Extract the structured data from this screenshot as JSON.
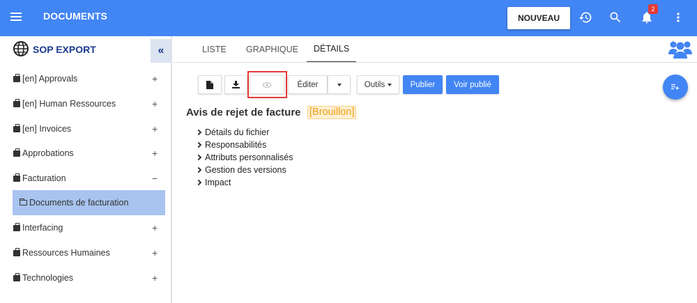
{
  "topbar": {
    "title": "DOCUMENTS",
    "new_button": "NOUVEAU",
    "notification_count": "2",
    "icons": [
      "menu-icon",
      "history-icon",
      "search-icon",
      "bell-icon",
      "more-vert-icon"
    ]
  },
  "sidebar": {
    "title": "SOP EXPORT",
    "collapse_glyph": "«",
    "items": [
      {
        "label": "[en] Approvals",
        "toggle": "+"
      },
      {
        "label": "[en] Human Ressources",
        "toggle": "+"
      },
      {
        "label": "[en] Invoices",
        "toggle": "+"
      },
      {
        "label": "Approbations",
        "toggle": "+"
      },
      {
        "label": "Facturation",
        "toggle": "−"
      },
      {
        "label": "Interfacing",
        "toggle": "+"
      },
      {
        "label": "Ressources Humaines",
        "toggle": "+"
      },
      {
        "label": "Technologies",
        "toggle": "+"
      }
    ],
    "sub_item": {
      "label": "Documents de facturation"
    }
  },
  "tabs": [
    {
      "label": "LISTE"
    },
    {
      "label": "GRAPHIQUE"
    },
    {
      "label": "DÉTAILS"
    }
  ],
  "toolbar": {
    "edit_label": "Éditer",
    "tools_label": "Outils",
    "publish_label": "Publier",
    "view_published_label": "Voir publié"
  },
  "document": {
    "title": "Avis de rejet de facture",
    "status": "[Brouillon]",
    "sections": [
      {
        "label": "Détails du fichier"
      },
      {
        "label": "Responsabilités"
      },
      {
        "label": "Attributs personnalisés"
      },
      {
        "label": "Gestion des versions"
      },
      {
        "label": "Impact"
      }
    ]
  },
  "colors": {
    "primary": "#4285f4",
    "selected_item": "#a8c4ef",
    "status": "#f39c12",
    "highlight_box": "#e53935"
  }
}
